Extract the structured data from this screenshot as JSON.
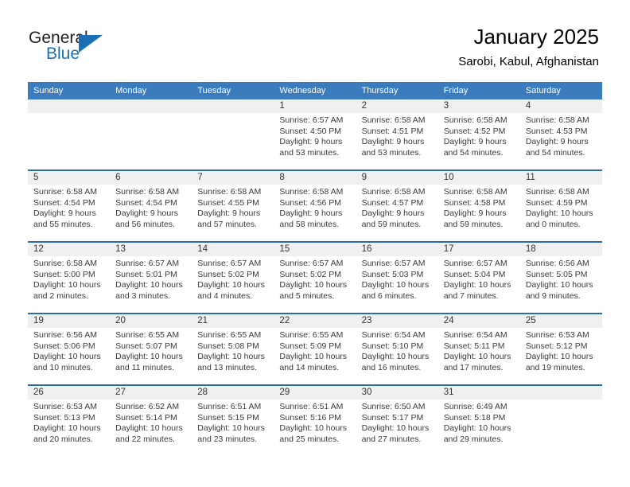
{
  "brand": {
    "name_part1": "General",
    "name_part2": "Blue",
    "flag_icon": "blue-triangle-flag-icon"
  },
  "header": {
    "title": "January 2025",
    "location": "Sarobi, Kabul, Afghanistan"
  },
  "calendar": {
    "weekdays": [
      "Sunday",
      "Monday",
      "Tuesday",
      "Wednesday",
      "Thursday",
      "Friday",
      "Saturday"
    ],
    "accent_color": "#3a7cbe",
    "header_divider_color": "#2d6ca8",
    "day_number_background": "#f0f0f0",
    "weeks": [
      [
        {
          "day": "",
          "sunrise": "",
          "sunset": "",
          "daylight1": "",
          "daylight2": ""
        },
        {
          "day": "",
          "sunrise": "",
          "sunset": "",
          "daylight1": "",
          "daylight2": ""
        },
        {
          "day": "",
          "sunrise": "",
          "sunset": "",
          "daylight1": "",
          "daylight2": ""
        },
        {
          "day": "1",
          "sunrise": "Sunrise: 6:57 AM",
          "sunset": "Sunset: 4:50 PM",
          "daylight1": "Daylight: 9 hours",
          "daylight2": "and 53 minutes."
        },
        {
          "day": "2",
          "sunrise": "Sunrise: 6:58 AM",
          "sunset": "Sunset: 4:51 PM",
          "daylight1": "Daylight: 9 hours",
          "daylight2": "and 53 minutes."
        },
        {
          "day": "3",
          "sunrise": "Sunrise: 6:58 AM",
          "sunset": "Sunset: 4:52 PM",
          "daylight1": "Daylight: 9 hours",
          "daylight2": "and 54 minutes."
        },
        {
          "day": "4",
          "sunrise": "Sunrise: 6:58 AM",
          "sunset": "Sunset: 4:53 PM",
          "daylight1": "Daylight: 9 hours",
          "daylight2": "and 54 minutes."
        }
      ],
      [
        {
          "day": "5",
          "sunrise": "Sunrise: 6:58 AM",
          "sunset": "Sunset: 4:54 PM",
          "daylight1": "Daylight: 9 hours",
          "daylight2": "and 55 minutes."
        },
        {
          "day": "6",
          "sunrise": "Sunrise: 6:58 AM",
          "sunset": "Sunset: 4:54 PM",
          "daylight1": "Daylight: 9 hours",
          "daylight2": "and 56 minutes."
        },
        {
          "day": "7",
          "sunrise": "Sunrise: 6:58 AM",
          "sunset": "Sunset: 4:55 PM",
          "daylight1": "Daylight: 9 hours",
          "daylight2": "and 57 minutes."
        },
        {
          "day": "8",
          "sunrise": "Sunrise: 6:58 AM",
          "sunset": "Sunset: 4:56 PM",
          "daylight1": "Daylight: 9 hours",
          "daylight2": "and 58 minutes."
        },
        {
          "day": "9",
          "sunrise": "Sunrise: 6:58 AM",
          "sunset": "Sunset: 4:57 PM",
          "daylight1": "Daylight: 9 hours",
          "daylight2": "and 59 minutes."
        },
        {
          "day": "10",
          "sunrise": "Sunrise: 6:58 AM",
          "sunset": "Sunset: 4:58 PM",
          "daylight1": "Daylight: 9 hours",
          "daylight2": "and 59 minutes."
        },
        {
          "day": "11",
          "sunrise": "Sunrise: 6:58 AM",
          "sunset": "Sunset: 4:59 PM",
          "daylight1": "Daylight: 10 hours",
          "daylight2": "and 0 minutes."
        }
      ],
      [
        {
          "day": "12",
          "sunrise": "Sunrise: 6:58 AM",
          "sunset": "Sunset: 5:00 PM",
          "daylight1": "Daylight: 10 hours",
          "daylight2": "and 2 minutes."
        },
        {
          "day": "13",
          "sunrise": "Sunrise: 6:57 AM",
          "sunset": "Sunset: 5:01 PM",
          "daylight1": "Daylight: 10 hours",
          "daylight2": "and 3 minutes."
        },
        {
          "day": "14",
          "sunrise": "Sunrise: 6:57 AM",
          "sunset": "Sunset: 5:02 PM",
          "daylight1": "Daylight: 10 hours",
          "daylight2": "and 4 minutes."
        },
        {
          "day": "15",
          "sunrise": "Sunrise: 6:57 AM",
          "sunset": "Sunset: 5:02 PM",
          "daylight1": "Daylight: 10 hours",
          "daylight2": "and 5 minutes."
        },
        {
          "day": "16",
          "sunrise": "Sunrise: 6:57 AM",
          "sunset": "Sunset: 5:03 PM",
          "daylight1": "Daylight: 10 hours",
          "daylight2": "and 6 minutes."
        },
        {
          "day": "17",
          "sunrise": "Sunrise: 6:57 AM",
          "sunset": "Sunset: 5:04 PM",
          "daylight1": "Daylight: 10 hours",
          "daylight2": "and 7 minutes."
        },
        {
          "day": "18",
          "sunrise": "Sunrise: 6:56 AM",
          "sunset": "Sunset: 5:05 PM",
          "daylight1": "Daylight: 10 hours",
          "daylight2": "and 9 minutes."
        }
      ],
      [
        {
          "day": "19",
          "sunrise": "Sunrise: 6:56 AM",
          "sunset": "Sunset: 5:06 PM",
          "daylight1": "Daylight: 10 hours",
          "daylight2": "and 10 minutes."
        },
        {
          "day": "20",
          "sunrise": "Sunrise: 6:55 AM",
          "sunset": "Sunset: 5:07 PM",
          "daylight1": "Daylight: 10 hours",
          "daylight2": "and 11 minutes."
        },
        {
          "day": "21",
          "sunrise": "Sunrise: 6:55 AM",
          "sunset": "Sunset: 5:08 PM",
          "daylight1": "Daylight: 10 hours",
          "daylight2": "and 13 minutes."
        },
        {
          "day": "22",
          "sunrise": "Sunrise: 6:55 AM",
          "sunset": "Sunset: 5:09 PM",
          "daylight1": "Daylight: 10 hours",
          "daylight2": "and 14 minutes."
        },
        {
          "day": "23",
          "sunrise": "Sunrise: 6:54 AM",
          "sunset": "Sunset: 5:10 PM",
          "daylight1": "Daylight: 10 hours",
          "daylight2": "and 16 minutes."
        },
        {
          "day": "24",
          "sunrise": "Sunrise: 6:54 AM",
          "sunset": "Sunset: 5:11 PM",
          "daylight1": "Daylight: 10 hours",
          "daylight2": "and 17 minutes."
        },
        {
          "day": "25",
          "sunrise": "Sunrise: 6:53 AM",
          "sunset": "Sunset: 5:12 PM",
          "daylight1": "Daylight: 10 hours",
          "daylight2": "and 19 minutes."
        }
      ],
      [
        {
          "day": "26",
          "sunrise": "Sunrise: 6:53 AM",
          "sunset": "Sunset: 5:13 PM",
          "daylight1": "Daylight: 10 hours",
          "daylight2": "and 20 minutes."
        },
        {
          "day": "27",
          "sunrise": "Sunrise: 6:52 AM",
          "sunset": "Sunset: 5:14 PM",
          "daylight1": "Daylight: 10 hours",
          "daylight2": "and 22 minutes."
        },
        {
          "day": "28",
          "sunrise": "Sunrise: 6:51 AM",
          "sunset": "Sunset: 5:15 PM",
          "daylight1": "Daylight: 10 hours",
          "daylight2": "and 23 minutes."
        },
        {
          "day": "29",
          "sunrise": "Sunrise: 6:51 AM",
          "sunset": "Sunset: 5:16 PM",
          "daylight1": "Daylight: 10 hours",
          "daylight2": "and 25 minutes."
        },
        {
          "day": "30",
          "sunrise": "Sunrise: 6:50 AM",
          "sunset": "Sunset: 5:17 PM",
          "daylight1": "Daylight: 10 hours",
          "daylight2": "and 27 minutes."
        },
        {
          "day": "31",
          "sunrise": "Sunrise: 6:49 AM",
          "sunset": "Sunset: 5:18 PM",
          "daylight1": "Daylight: 10 hours",
          "daylight2": "and 29 minutes."
        },
        {
          "day": "",
          "sunrise": "",
          "sunset": "",
          "daylight1": "",
          "daylight2": ""
        }
      ]
    ]
  }
}
